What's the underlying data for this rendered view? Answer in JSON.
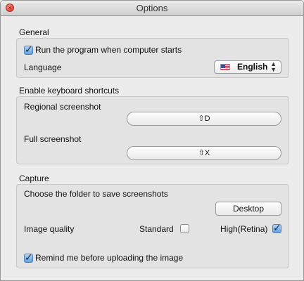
{
  "window": {
    "title": "Options"
  },
  "general": {
    "heading": "General",
    "run_on_startup": {
      "label": "Run the program when computer starts",
      "checked": true
    },
    "language": {
      "label": "Language",
      "value": "English"
    }
  },
  "shortcuts": {
    "heading": "Enable keyboard shortcuts",
    "regional": {
      "label": "Regional screenshot",
      "key": "⇧D"
    },
    "full": {
      "label": "Full screenshot",
      "key": "⇧X"
    }
  },
  "capture": {
    "heading": "Capture",
    "folder_label": "Choose the folder to save screenshots",
    "folder_button": "Desktop",
    "quality_label": "Image quality",
    "standard": {
      "label": "Standard",
      "checked": false
    },
    "retina": {
      "label": "High(Retina)",
      "checked": true
    },
    "remind": {
      "label": "Remind me before uploading the image",
      "checked": true
    }
  },
  "icons": {
    "check": "✓",
    "updown_up": "▲",
    "updown_down": "▼",
    "close": "×"
  }
}
